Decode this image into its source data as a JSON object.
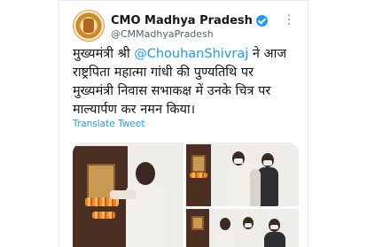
{
  "tweet": {
    "account_name": "CMO Madhya Pradesh",
    "handle": "@CMMadhyaPradesh",
    "text_lines": [
      "मुख्यमंत्री श्री ",
      "@ChouhanShivraj",
      " ने आज",
      "राष्ट्रपिता महात्मा गांधी की पुण्यतिथि पर",
      "मुख्यमंत्री निवास सभाकक्ष में उनके चित्र पर",
      "माल्यार्पण कर नमन किया।"
    ],
    "translate_label": "Translate Tweet"
  },
  "icons": {
    "verified": "verified-badge-icon",
    "more": "more-options-icon",
    "avatar": "cmo-madhya-pradesh-emblem"
  },
  "colors": {
    "accent": "#1d9bf0",
    "text": "#0f1419",
    "muted": "#536471"
  }
}
